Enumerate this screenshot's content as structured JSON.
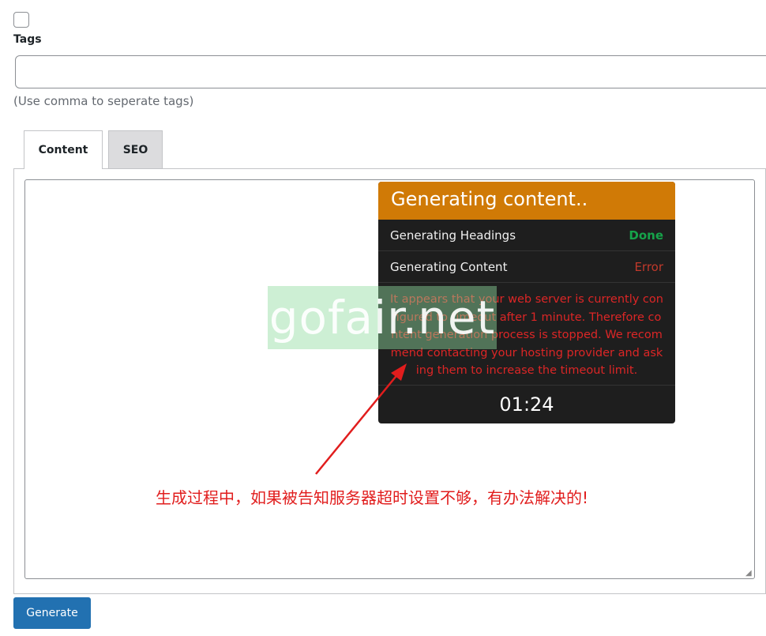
{
  "form": {
    "tags_label": "Tags",
    "tags_value": "",
    "tags_hint": "(Use comma to seperate tags)"
  },
  "tabs": [
    {
      "label": "Content",
      "active": true
    },
    {
      "label": "SEO",
      "active": false
    }
  ],
  "modal": {
    "title": "Generating content..",
    "steps": [
      {
        "label": "Generating Headings",
        "status": "Done",
        "status_color": "#16a34a"
      },
      {
        "label": "Generating Content",
        "status": "Error",
        "status_color": "#c0392b"
      }
    ],
    "error_message": "It appears that your web server is currently configured to timeout after 1 minute. Therefore content generation process is stopped. We recommend contacting your hosting provider and asking them to increase the timeout limit.",
    "timer": "01:24",
    "header_color": "#d07a06"
  },
  "watermark": "gofair.net",
  "annotation": "生成过程中，如果被告知服务器超时设置不够，有办法解决的!",
  "actions": {
    "generate_label": "Generate"
  },
  "colors": {
    "primary": "#2271b1",
    "annotation_red": "#e11d1d"
  }
}
